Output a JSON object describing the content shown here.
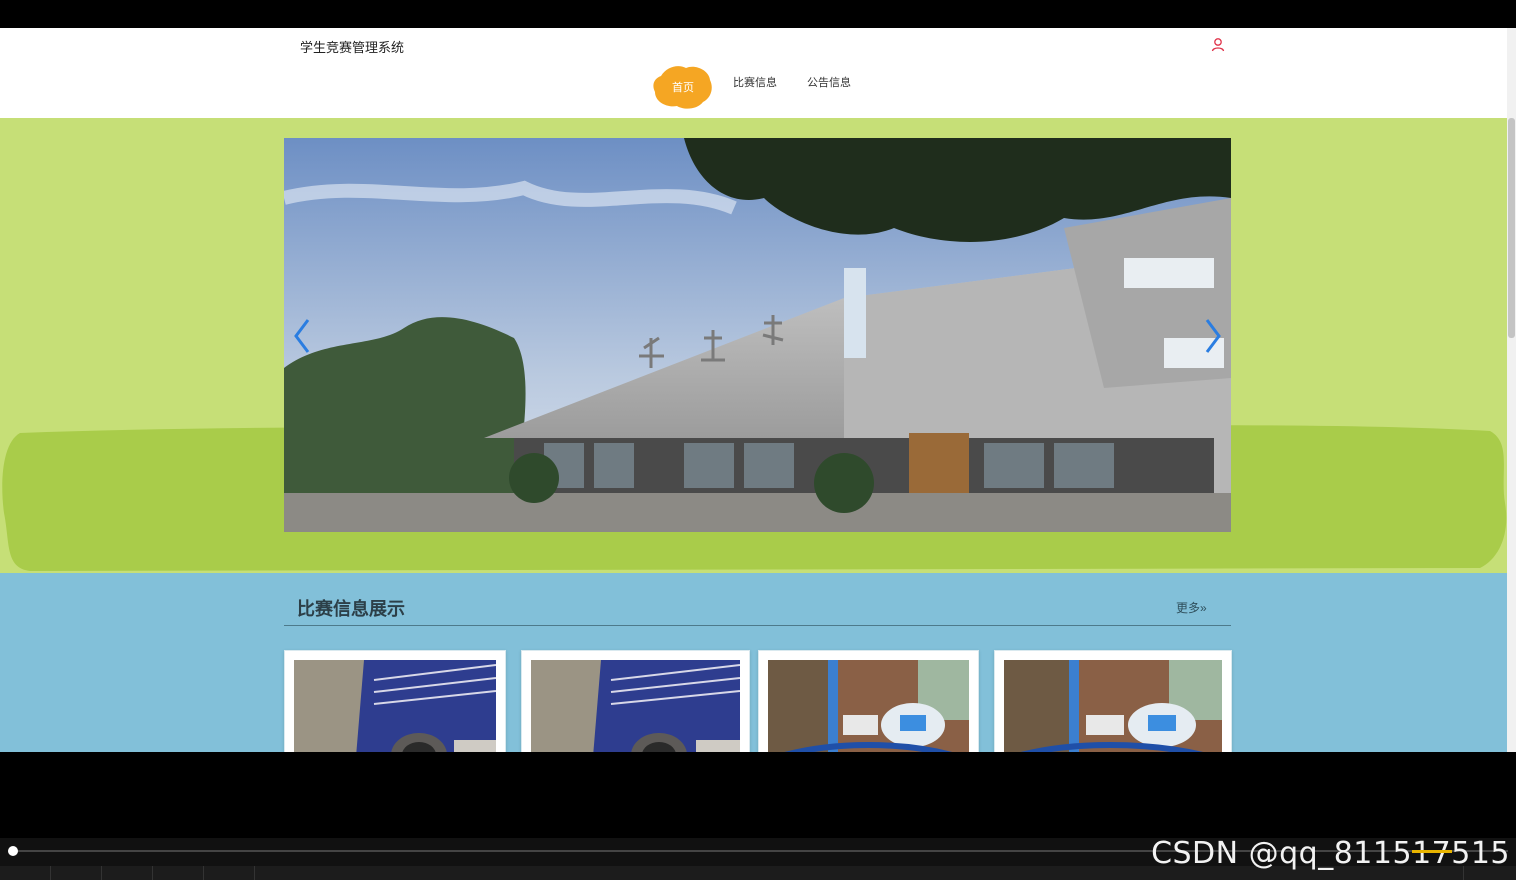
{
  "header": {
    "site_title": "学生竞赛管理系统",
    "user_icon": "user-icon"
  },
  "nav": {
    "items": [
      {
        "label": "首页",
        "active": true
      },
      {
        "label": "比赛信息",
        "active": false
      },
      {
        "label": "公告信息",
        "active": false
      }
    ]
  },
  "banner": {
    "prev_icon": "chevron-left-icon",
    "next_icon": "chevron-right-icon"
  },
  "section": {
    "title": "比赛信息展示",
    "more_label": "更多",
    "more_icon": "double-chevron-right-icon"
  },
  "watermark": {
    "text": "CSDN @qq_811517515"
  },
  "colors": {
    "banner_green": "#c6df77",
    "blob_green": "#a9cc4a",
    "section_blue": "#82c0d9",
    "nav_active": "#f5a623",
    "arrow_blue": "#2a7de1",
    "user_icon": "#e0334a"
  }
}
